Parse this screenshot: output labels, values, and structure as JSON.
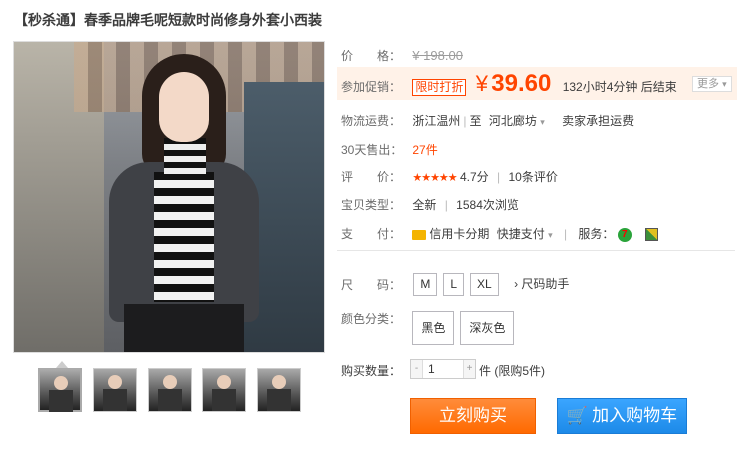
{
  "title": "【秒杀通】春季品牌毛呢短款时尚修身外套小西装",
  "price": {
    "label": "价　　格：",
    "old": "¥ 198.00"
  },
  "promo": {
    "label": "参加促销：",
    "tag": "限时打折",
    "yen": "¥",
    "value": "39.60",
    "countdown": "132小时4分钟 后结束",
    "more": "更多"
  },
  "shipping": {
    "label": "物流运费：",
    "from": "浙江温州",
    "to_prefix": "至",
    "to": "河北廊坊",
    "fee": "卖家承担运费"
  },
  "sold": {
    "label": "30天售出：",
    "count": "27件"
  },
  "rating": {
    "label": "评　　价：",
    "stars": "★★★★★",
    "score": "4.7分",
    "reviews": "10条评价",
    "star_value": 4.7,
    "star_max": 5
  },
  "type": {
    "label": "宝贝类型：",
    "condition": "全新",
    "views": "1584次浏览"
  },
  "payment": {
    "label": "支　　付：",
    "card": "信用卡分期",
    "quick": "快捷支付",
    "service_label": "服务："
  },
  "size": {
    "label": "尺　　码：",
    "options": [
      "M",
      "L",
      "XL"
    ],
    "helper": "尺码助手"
  },
  "color": {
    "label": "颜色分类：",
    "options": [
      "黑色",
      "深灰色"
    ]
  },
  "quantity": {
    "label": "购买数量：",
    "value": "1",
    "minus": "-",
    "plus": "+",
    "suffix": "件 (限购5件)"
  },
  "buttons": {
    "buy": "立刻购买",
    "cart": "加入购物车"
  },
  "colors": {
    "accent": "#ff4400",
    "buy": "#ff6a00",
    "cart": "#1d8ae8"
  }
}
